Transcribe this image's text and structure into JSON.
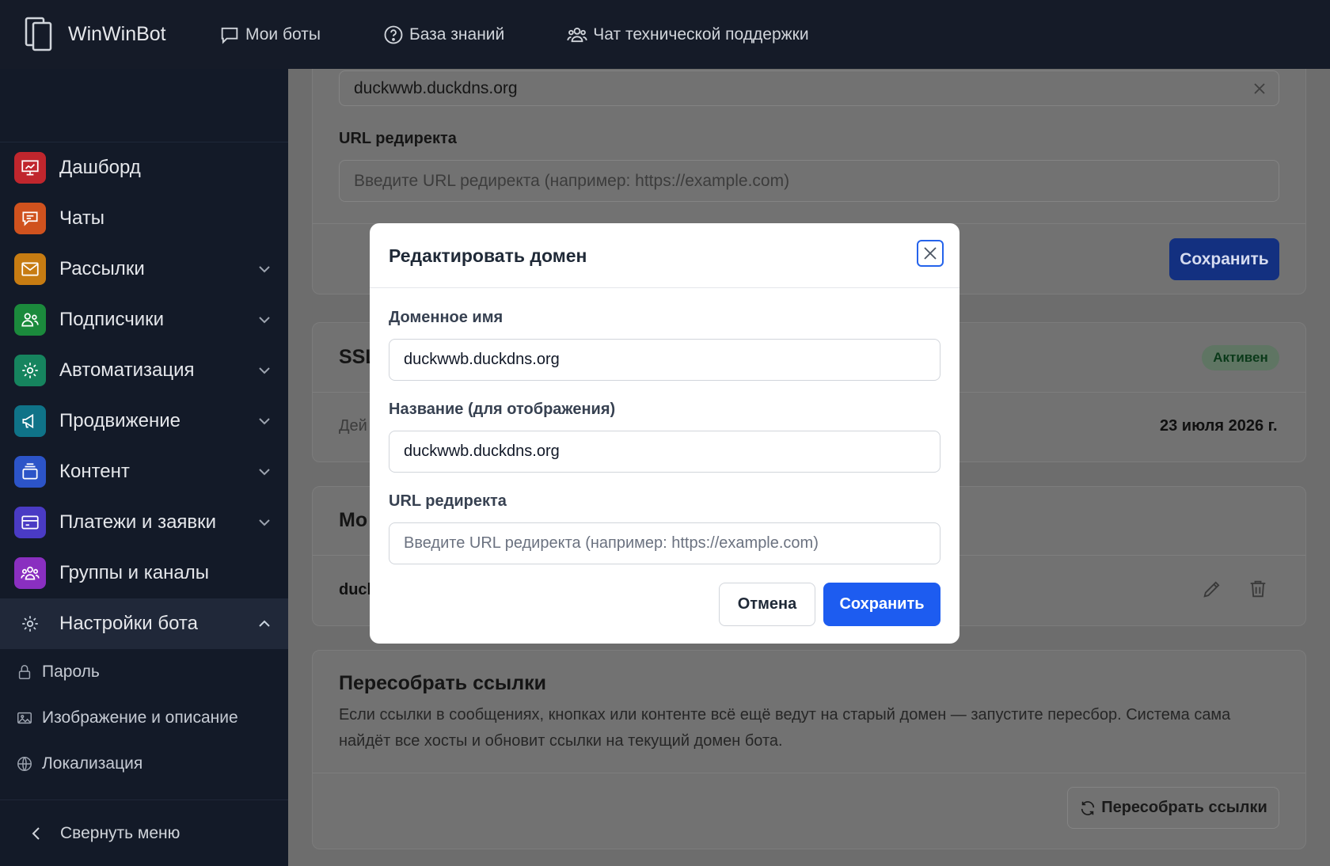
{
  "app": {
    "name": "WinWinBot"
  },
  "topnav": [
    {
      "label": "Мои боты",
      "icon": "chat-bubble-icon"
    },
    {
      "label": "База знаний",
      "icon": "help-circle-icon"
    },
    {
      "label": "Чат технической поддержки",
      "icon": "users-icon"
    }
  ],
  "sidebar": {
    "items": [
      {
        "label": "Дашборд",
        "icon": "presentation-chart-icon",
        "color": "#c0262d"
      },
      {
        "label": "Чаты",
        "icon": "chat-icon",
        "color": "#d0521e"
      },
      {
        "label": "Рассылки",
        "icon": "mail-icon",
        "color": "#c77c12"
      },
      {
        "label": "Подписчики",
        "icon": "users-icon",
        "color": "#1b8a3c"
      },
      {
        "label": "Автоматизация",
        "icon": "gear-icon",
        "color": "#16845e"
      },
      {
        "label": "Продвижение",
        "icon": "megaphone-icon",
        "color": "#0f7388"
      },
      {
        "label": "Контент",
        "icon": "stack-icon",
        "color": "#2c54c8"
      },
      {
        "label": "Платежи и заявки",
        "icon": "credit-card-icon",
        "color": "#4a3bc4"
      },
      {
        "label": "Группы и каналы",
        "icon": "group-icon",
        "color": "#8a2fc0"
      },
      {
        "label": "Настройки бота",
        "icon": "gear-icon"
      }
    ],
    "sub_items": [
      {
        "label": "Пароль",
        "icon": "lock-icon"
      },
      {
        "label": "Изображение и описание",
        "icon": "image-icon"
      },
      {
        "label": "Локализация",
        "icon": "globe-icon"
      }
    ],
    "collapse_label": "Свернуть меню"
  },
  "background": {
    "domain_value": "duckwwb.duckdns.org",
    "redirect_label": "URL редиректа",
    "redirect_placeholder": "Введите URL редиректа (например: https://example.com)",
    "save_label": "Сохранить",
    "ssl_title_partial": "SSL",
    "ssl_badge": "Активен",
    "ssl_row_partial": "Дей",
    "ssl_date": "23 июля 2026 г.",
    "domains_title_partial": "Мо",
    "domain_row_partial": "duck",
    "rebuild_title": "Пересобрать ссылки",
    "rebuild_desc": "Если ссылки в сообщениях, кнопках или контенте всё ещё ведут на старый домен — запустите пересбор. Система сама найдёт все хосты и обновит ссылки на текущий домен бота.",
    "rebuild_button": "Пересобрать ссылки"
  },
  "modal": {
    "title": "Редактировать домен",
    "domain_label": "Доменное имя",
    "domain_value": "duckwwb.duckdns.org",
    "display_label": "Название (для отображения)",
    "display_value": "duckwwb.duckdns.org",
    "redirect_label": "URL редиректа",
    "redirect_placeholder": "Введите URL редиректа (например: https://example.com)",
    "cancel_label": "Отмена",
    "save_label": "Сохранить"
  },
  "colors": {
    "primary": "#1d5cf0",
    "topbar": "#151b28",
    "sidebar": "#131a28"
  }
}
